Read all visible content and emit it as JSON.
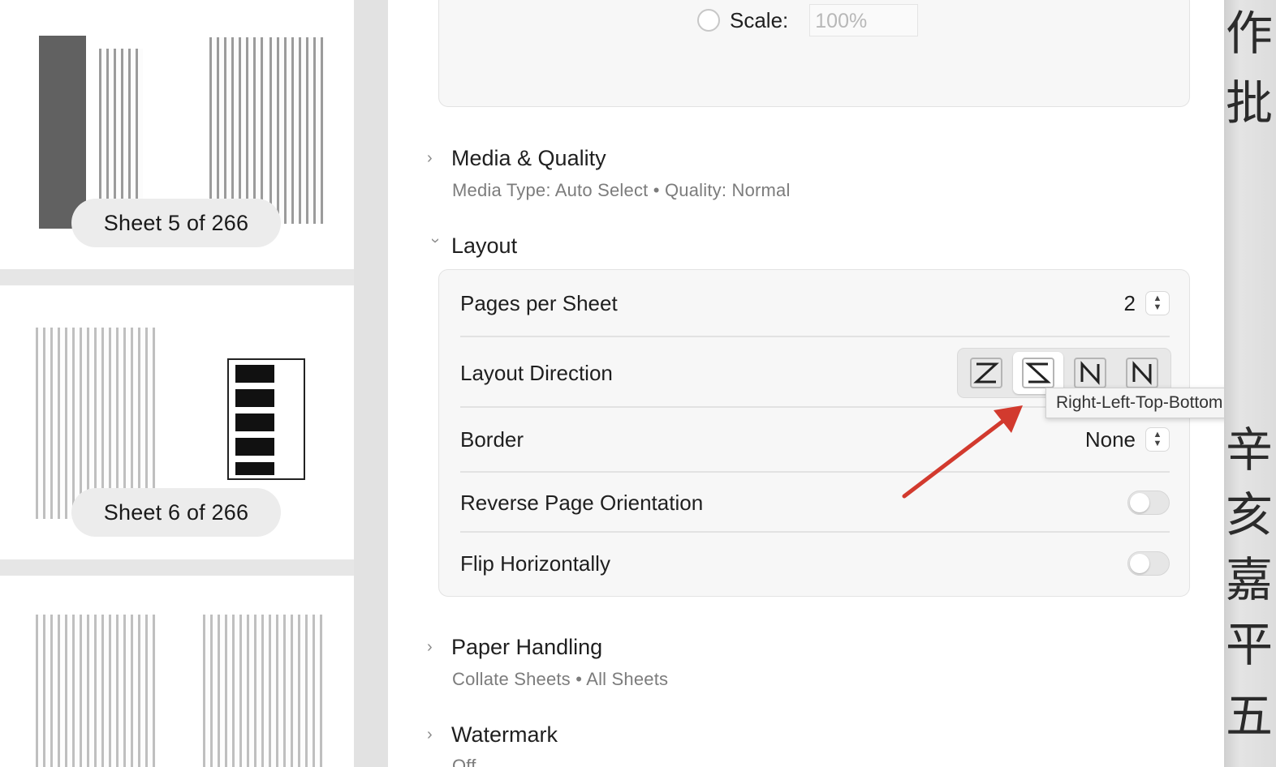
{
  "preview": {
    "sheets": [
      {
        "label": "Sheet 5 of 266"
      },
      {
        "label": "Sheet 6 of 266"
      }
    ]
  },
  "scale": {
    "label": "Scale:",
    "value": "100%"
  },
  "sections": {
    "media_quality": {
      "title": "Media & Quality",
      "summary": "Media Type: Auto Select • Quality: Normal"
    },
    "layout": {
      "title": "Layout"
    },
    "paper_handling": {
      "title": "Paper Handling",
      "summary": "Collate Sheets • All Sheets"
    },
    "watermark": {
      "title": "Watermark",
      "summary": "Off"
    }
  },
  "layout": {
    "pages_per_sheet": {
      "label": "Pages per Sheet",
      "value": "2"
    },
    "layout_direction": {
      "label": "Layout Direction",
      "options": [
        "left-right-top-bottom-icon",
        "right-left-top-bottom-icon",
        "top-bottom-right-left-icon",
        "top-bottom-left-right-icon"
      ],
      "selected_index": 1,
      "tooltip": "Right-Left-Top-Bottom"
    },
    "border": {
      "label": "Border",
      "value": "None"
    },
    "reverse_page_orientation": {
      "label": "Reverse Page Orientation",
      "on": false
    },
    "flip_horizontally": {
      "label": "Flip Horizontally",
      "on": false
    }
  },
  "background_chars": [
    "作",
    "批",
    "辛",
    "亥",
    "嘉",
    "平",
    "五"
  ],
  "colors": {
    "annotation_arrow": "#d23a2e",
    "panel_bg": "#f7f7f7"
  }
}
